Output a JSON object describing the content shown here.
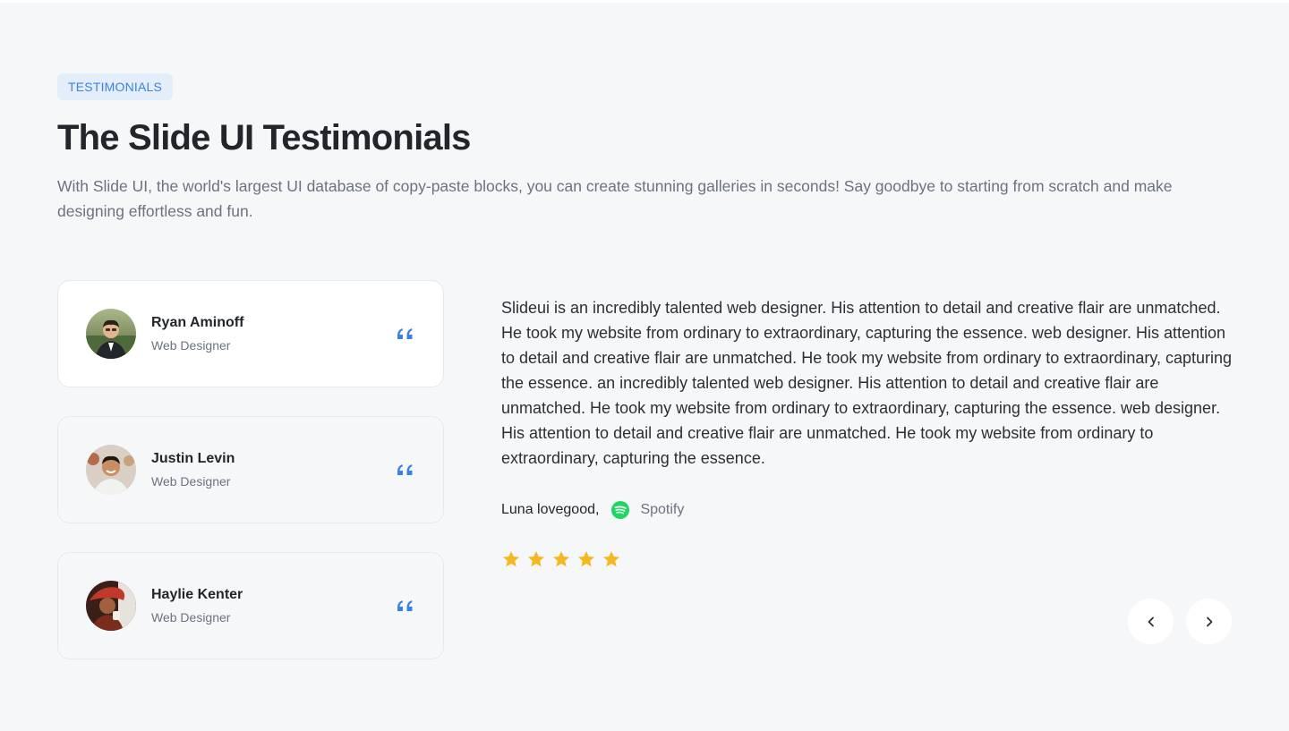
{
  "section": {
    "badge": "TESTIMONIALS",
    "title": "The Slide UI Testimonials",
    "subtitle": "With Slide UI, the world's largest UI database of copy-paste blocks, you can create stunning galleries in seconds! Say goodbye to starting from scratch and make designing effortless and fun."
  },
  "testimonials": [
    {
      "name": "Ryan Aminoff",
      "role": "Web Designer",
      "active": true
    },
    {
      "name": "Justin Levin",
      "role": "Web Designer",
      "active": false
    },
    {
      "name": "Haylie Kenter",
      "role": "Web Designer",
      "active": false
    }
  ],
  "review": {
    "text": "Slideui is an incredibly talented web designer. His attention to detail and creative flair are unmatched. He took my website from ordinary to extraordinary, capturing the essence. web designer. His attention to detail and creative flair are unmatched. He took my website from ordinary to extraordinary, capturing the essence. an incredibly talented web designer. His attention to detail and creative flair are unmatched. He took my website from ordinary to extraordinary, capturing the essence. web designer. His attention to detail and creative flair are unmatched. He took my website from ordinary to extraordinary, capturing the essence.",
    "author": "Luna lovegood,",
    "company": "Spotify",
    "company_icon": "spotify-icon",
    "rating": 5,
    "rating_max": 5
  },
  "icons": {
    "quote": "quote-icon",
    "star": "star-icon",
    "prev": "chevron-left-icon",
    "next": "chevron-right-icon"
  },
  "colors": {
    "accent": "#3b82e0",
    "badge_bg": "#e4eefb",
    "star": "#f5b820",
    "spotify": "#1ed760",
    "background": "#f6f7f9",
    "card_active": "#ffffff"
  }
}
